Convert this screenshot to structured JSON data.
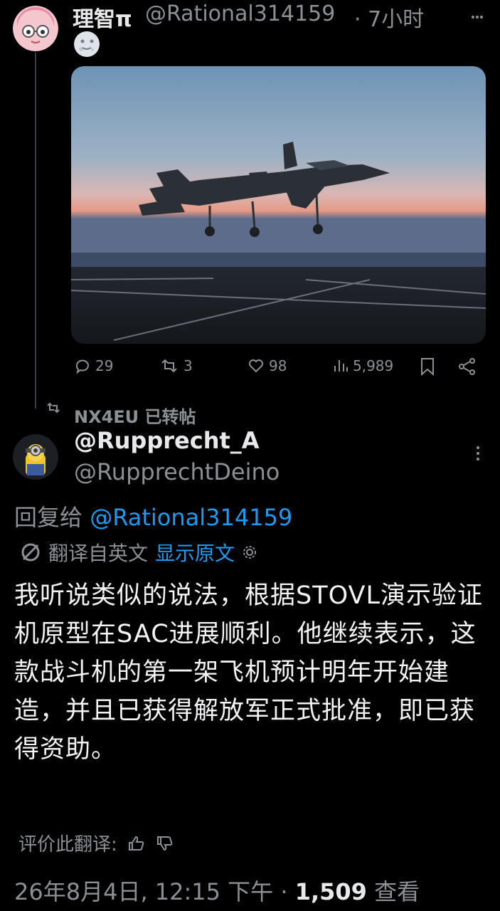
{
  "tweet1": {
    "display_name": "理智π",
    "handle": "@Rational314159",
    "time": "· 7小时",
    "emoji": "🌝",
    "stats": {
      "replies": "29",
      "reposts": "3",
      "likes": "98",
      "views": "5,989"
    }
  },
  "repost_banner": "NX4EU 已转帖",
  "tweet2": {
    "display_name": "@Rupprecht_A",
    "handle": "@RupprechtDeino",
    "reply_prefix": "回复给",
    "reply_handle": "@Rational314159",
    "translated_label": "翻译自英文",
    "show_original": "显示原文",
    "body": "我听说类似的说法，根据STOVL演示验证机原型在SAC进展顺利。他继续表示，这款战斗机的第一架飞机预计明年开始建造，并且已获得解放军正式批准，即已获得资助。",
    "rate_label": "评价此翻译:",
    "date": "26年8月4日, 12:15 下午 ·",
    "views_count": "1,509",
    "views_label": "查看"
  },
  "colors": {
    "link": "#1d9bf0",
    "muted": "#8b9095",
    "text": "#e7e9ea",
    "bg": "#000000"
  }
}
